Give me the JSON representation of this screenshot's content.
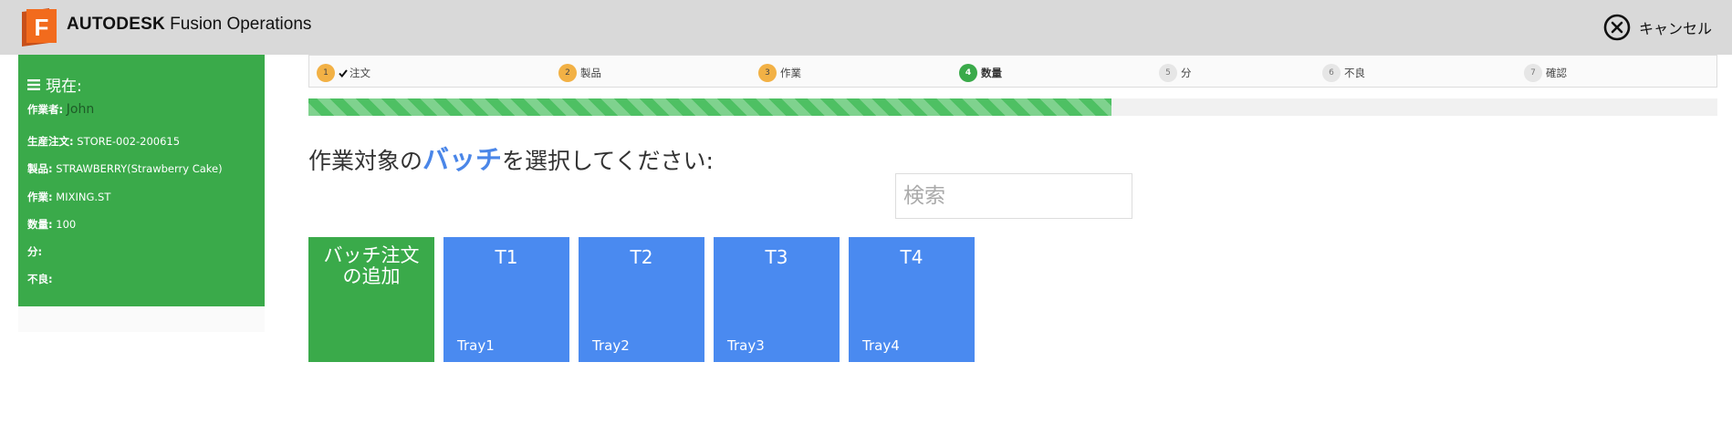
{
  "header": {
    "logo_letter": "F",
    "brand_bold": "AUTODESK",
    "brand_rest": "Fusion Operations",
    "cancel_label": "キャンセル",
    "colors": {
      "bar": "#d9d9d9",
      "logo": "#f26b1d"
    }
  },
  "sidebar": {
    "title": "現在:",
    "title_icon": "bars-icon",
    "rows": [
      {
        "key": "作業者:",
        "value": "John"
      },
      {
        "key": "生産注文:",
        "value": "STORE-002-200615"
      },
      {
        "key": "製品:",
        "value": "STRAWBERRY(Strawberry Cake)"
      },
      {
        "key": "作業:",
        "value": "MIXING.ST"
      },
      {
        "key": "数量:",
        "value": "100"
      },
      {
        "key": "分:",
        "value": ""
      },
      {
        "key": "不良:",
        "value": ""
      }
    ],
    "color": "#3aaa4a"
  },
  "stepper": {
    "steps": [
      {
        "num": "1",
        "label": "注文",
        "state": "done",
        "checked": true
      },
      {
        "num": "2",
        "label": "製品",
        "state": "done"
      },
      {
        "num": "3",
        "label": "作業",
        "state": "done"
      },
      {
        "num": "4",
        "label": "数量",
        "state": "current"
      },
      {
        "num": "5",
        "label": "分",
        "state": "todo"
      },
      {
        "num": "6",
        "label": "不良",
        "state": "todo"
      },
      {
        "num": "7",
        "label": "確認",
        "state": "todo"
      }
    ]
  },
  "progress": {
    "percent": 57
  },
  "prompt": {
    "before": "作業対象の",
    "highlight": "バッチ",
    "after": "を選択してください:"
  },
  "search": {
    "placeholder": "検索",
    "value": ""
  },
  "tiles": {
    "add_label": "バッチ注文の追加",
    "add_lines": [
      "バッチ注文",
      "の追加"
    ],
    "batches": [
      {
        "code": "T1",
        "name": "Tray1"
      },
      {
        "code": "T2",
        "name": "Tray2"
      },
      {
        "code": "T3",
        "name": "Tray3"
      },
      {
        "code": "T4",
        "name": "Tray4"
      }
    ],
    "colors": {
      "add": "#3aaa4a",
      "batch": "#4a8af0"
    }
  }
}
